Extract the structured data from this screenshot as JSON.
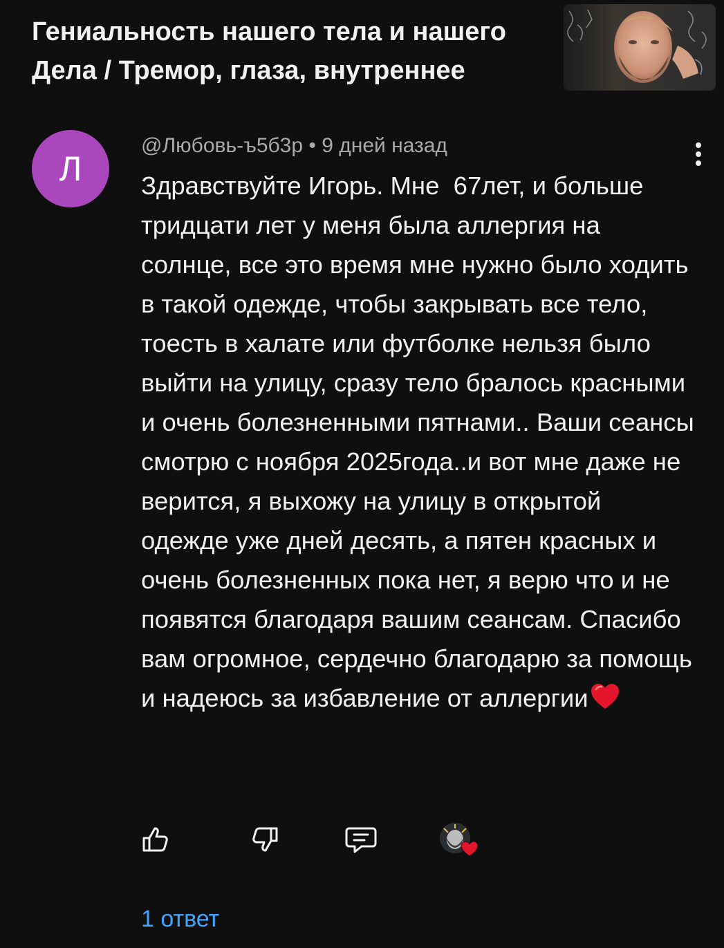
{
  "video": {
    "title": "Гениальность нашего тела и нашего Дела / Тремор, глаза, внутреннее"
  },
  "comment": {
    "avatar_letter": "Л",
    "avatar_color": "#ab47bc",
    "author": "@Любовь-ъ5б3р",
    "separator": "•",
    "time_ago": "9 дней назад",
    "text": "Здравствуйте Игорь. Мне  67лет, и больше тридцати лет у меня была аллергия на солнце, все это время мне нужно было ходить в такой одежде, чтобы закрывать все тело, тоесть в халате или футболке нельзя было выйти на улицу, сразу тело бралось красными и очень болезненными пятнами.. Ваши сеансы смотрю с ноября 2025года..и вот мне даже не верится, я выхожу на улицу в открытой одежде уже дней десять, а пятен красных и очень болезненных пока нет, я верю что и не появятся благодаря вашим сеансам. Спасибо вам огромное, сердечно благодарю за помощь и надеюсь за избавление от аллергии",
    "text_emoji": "heart-emoji",
    "replies_label": "1 ответ"
  },
  "icons": {
    "like": "thumbs-up-icon",
    "dislike": "thumbs-down-icon",
    "reply": "reply-icon",
    "more": "more-vertical-icon",
    "creator_heart": "creator-heart-icon"
  },
  "colors": {
    "background": "#0f0f0f",
    "text_primary": "#f1f1f1",
    "text_secondary": "#aaaaaa",
    "link": "#3ea6ff",
    "heart": "#e5162c"
  }
}
